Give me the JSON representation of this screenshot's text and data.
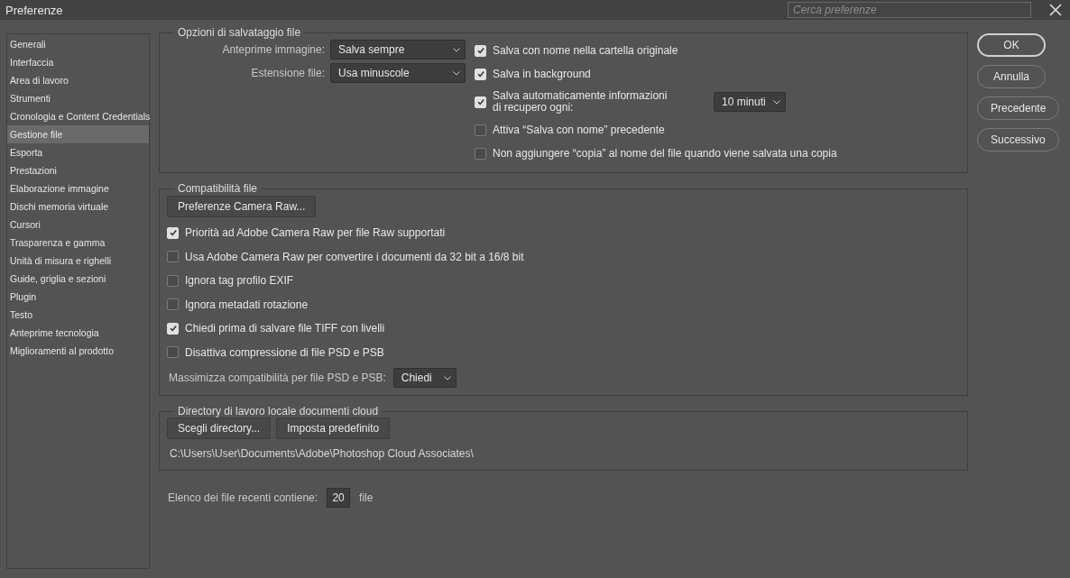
{
  "window": {
    "title": "Preferenze"
  },
  "search": {
    "placeholder": "Cerca preferenze"
  },
  "sidebar": {
    "items": [
      {
        "label": "Generali",
        "selected": false
      },
      {
        "label": "Interfaccia",
        "selected": false
      },
      {
        "label": "Area di lavoro",
        "selected": false
      },
      {
        "label": "Strumenti",
        "selected": false
      },
      {
        "label": "Cronologia e Content Credentials",
        "selected": false
      },
      {
        "label": "Gestione file",
        "selected": true
      },
      {
        "label": "Esporta",
        "selected": false
      },
      {
        "label": "Prestazioni",
        "selected": false
      },
      {
        "label": "Elaborazione immagine",
        "selected": false
      },
      {
        "label": "Dischi memoria virtuale",
        "selected": false
      },
      {
        "label": "Cursori",
        "selected": false
      },
      {
        "label": "Trasparenza e gamma",
        "selected": false
      },
      {
        "label": "Unità di misura e righelli",
        "selected": false
      },
      {
        "label": "Guide, griglia e sezioni",
        "selected": false
      },
      {
        "label": "Plugin",
        "selected": false
      },
      {
        "label": "Testo",
        "selected": false
      },
      {
        "label": "Anteprime tecnologia",
        "selected": false
      },
      {
        "label": "Miglioramenti al prodotto",
        "selected": false
      }
    ]
  },
  "file_save_options": {
    "title": "Opzioni di salvataggio file",
    "fields": [
      {
        "label": "Anteprime immagine:",
        "value": "Salva sempre"
      },
      {
        "label": "Estensione file:",
        "value": "Usa minuscole"
      }
    ],
    "checkboxes": [
      {
        "label": "Salva con nome nella cartella originale",
        "checked": true
      },
      {
        "label": "Salva in background",
        "checked": true
      },
      {
        "label": "Salva automaticamente informazioni di recupero ogni:",
        "checked": true,
        "interval": "10 minuti"
      },
      {
        "label": "Attiva “Salva con nome” precedente",
        "checked": false
      },
      {
        "label": "Non aggiungere “copia” al nome del file quando viene salvata una copia",
        "checked": false
      }
    ]
  },
  "file_compatibility": {
    "title": "Compatibilità file",
    "button": "Preferenze Camera Raw...",
    "checkboxes": [
      {
        "label": "Priorità ad Adobe Camera Raw per file Raw supportati",
        "checked": true
      },
      {
        "label": "Usa Adobe Camera Raw per convertire i documenti da 32 bit a 16/8 bit",
        "checked": false
      },
      {
        "label": "Ignora tag profilo EXIF",
        "checked": false
      },
      {
        "label": "Ignora metadati rotazione",
        "checked": false
      },
      {
        "label": "Chiedi prima di salvare file TIFF con livelli",
        "checked": true
      },
      {
        "label": "Disattiva compressione di file PSD e PSB",
        "checked": false
      }
    ],
    "maximize": {
      "label": "Massimizza compatibilità per file PSD e PSB:",
      "value": "Chiedi"
    }
  },
  "cloud_directory": {
    "title": "Directory di lavoro locale documenti cloud",
    "buttons": [
      "Scegli directory...",
      "Imposta predefinito"
    ],
    "path": "C:\\Users\\User\\Documents\\Adobe\\Photoshop Cloud Associates\\"
  },
  "recent_files": {
    "label": "Elenco dei file recenti contiene:",
    "value": "20",
    "unit": "file"
  },
  "dialog_buttons": [
    {
      "label": "OK",
      "default": true
    },
    {
      "label": "Annulla",
      "default": false
    },
    {
      "label": "Precedente",
      "default": false
    },
    {
      "label": "Successivo",
      "default": false
    }
  ]
}
